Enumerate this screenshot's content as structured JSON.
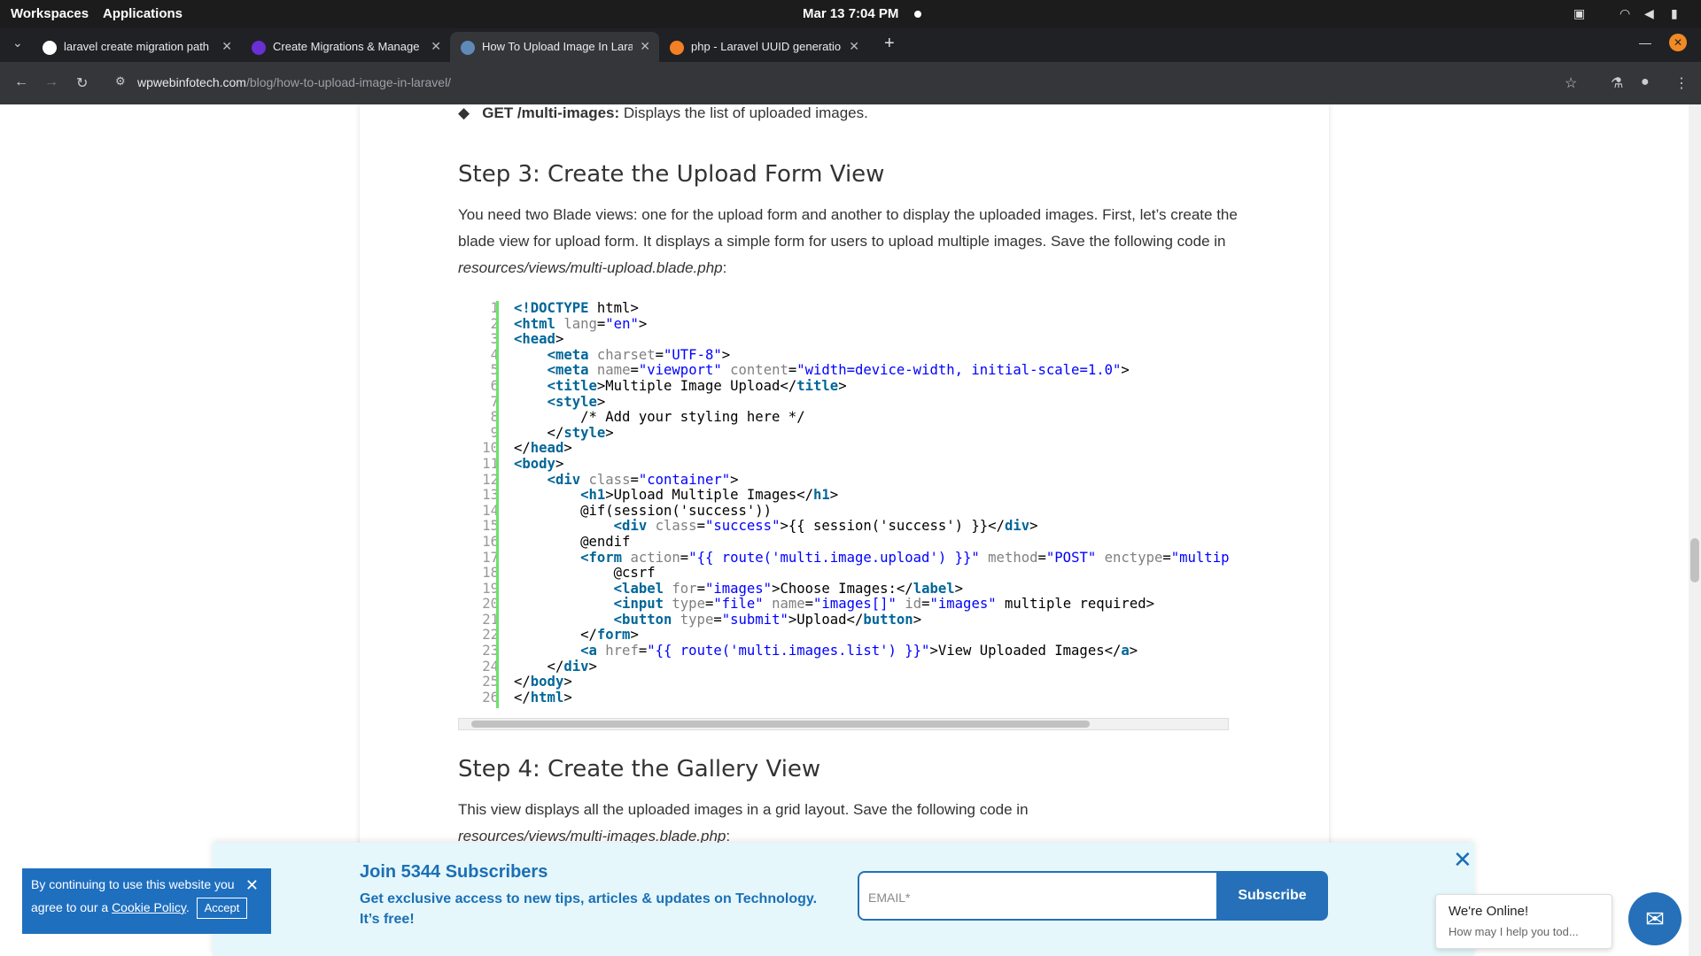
{
  "system_bar": {
    "workspaces": "Workspaces",
    "applications": "Applications",
    "datetime": "Mar 13  7:04 PM"
  },
  "tabs": [
    {
      "title": "laravel create migration path",
      "active": false,
      "icon": "google-icon"
    },
    {
      "title": "Create Migrations & Manage",
      "active": false,
      "icon": "site-icon"
    },
    {
      "title": "How To Upload Image In Laravel",
      "active": true,
      "icon": "wp-icon"
    },
    {
      "title": "php - Laravel UUID generation",
      "active": false,
      "icon": "stack-icon"
    }
  ],
  "address": {
    "domain": "wpwebinfotech.com",
    "path": "/blog/how-to-upload-image-in-laravel/"
  },
  "article": {
    "bullet_bold": "GET /multi-images:",
    "bullet_text": " Displays the list of uploaded images.",
    "step3_heading": "Step 3: Create the Upload Form View",
    "step3_p1": "You need two Blade views: one for the upload form and another to display the uploaded images. First, let’s create the blade view for upload form. It displays a simple form for users to upload multiple images. Save the following code in ",
    "step3_path": "resources/views/multi-upload.blade.php",
    "step3_colon": ":",
    "step4_heading": "Step 4: Create the Gallery View",
    "step4_p1": "This view displays all the uploaded images in a grid layout. Save the following code in ",
    "step4_path": "resources/views/multi-images.blade.php",
    "step4_colon": ":"
  },
  "code": {
    "line_numbers": "1\n2\n3\n4\n5\n6\n7\n8\n9\n10\n11\n12\n13\n14\n15\n16\n17\n18\n19\n20\n21\n22\n23\n24\n25\n26"
  },
  "subscribe": {
    "title": "Join 5344 Subscribers",
    "subtitle": "Get exclusive access to new tips, articles & updates on Technology. It’s free!",
    "email_placeholder": "EMAIL*",
    "button": "Subscribe"
  },
  "cookie": {
    "text1": "By continuing to use this website you agree to our a ",
    "link": "Cookie Policy",
    "text2": ".",
    "accept": "Accept"
  },
  "chat": {
    "title": "We're Online!",
    "subtitle": "How may I help you tod..."
  }
}
